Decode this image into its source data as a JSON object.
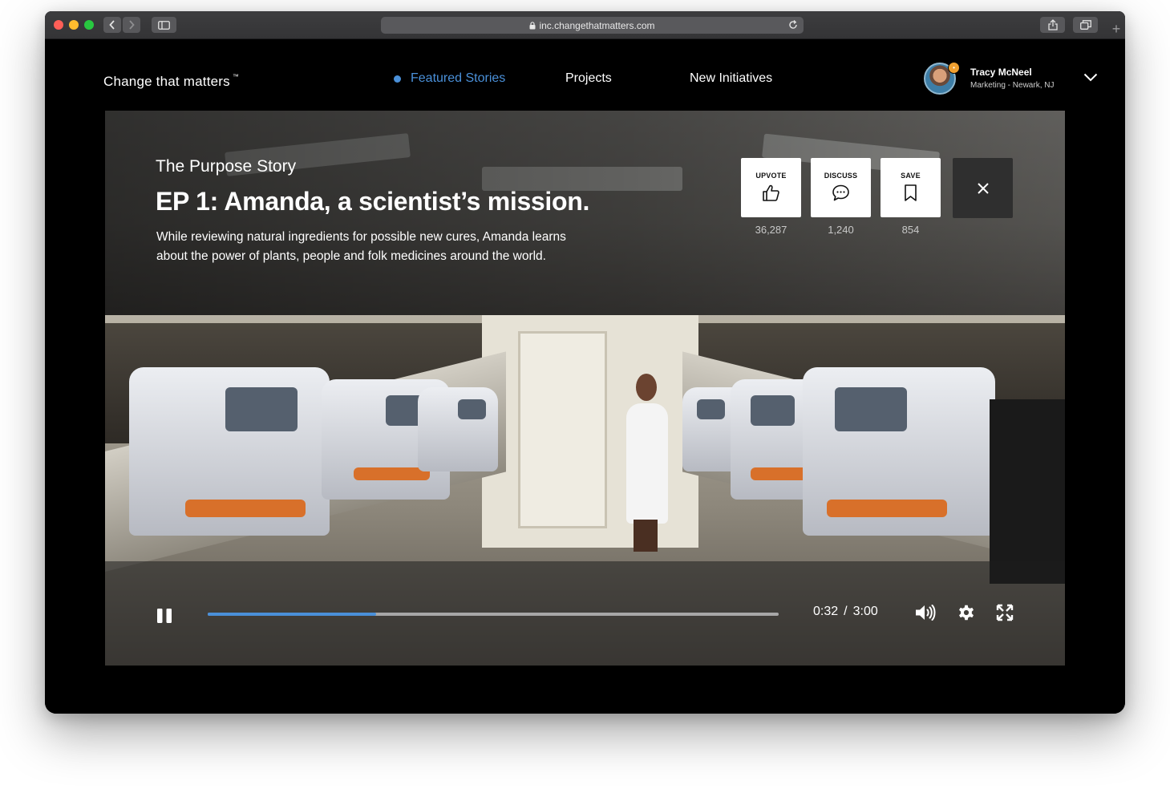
{
  "browser": {
    "url": "inc.changethatmatters.com"
  },
  "site": {
    "brand": "Change that matters",
    "brand_mark": "™",
    "nav": [
      {
        "label": "Featured Stories",
        "active": true
      },
      {
        "label": "Projects",
        "active": false
      },
      {
        "label": "New Initiatives",
        "active": false
      }
    ],
    "user": {
      "name": "Tracy McNeel",
      "subtitle": "Marketing - Newark, NJ"
    },
    "accent_color": "#4a90d9"
  },
  "story": {
    "series": "The Purpose Story",
    "title": "EP 1: Amanda, a scientist’s mission.",
    "description": "While reviewing natural ingredients for possible new cures, Amanda learns about the power of plants, people and folk medicines around the world.",
    "actions": [
      {
        "label": "UPVOTE",
        "count": "36,287",
        "icon": "thumbs-up-icon"
      },
      {
        "label": "DISCUSS",
        "count": "1,240",
        "icon": "speech-bubble-icon"
      },
      {
        "label": "SAVE",
        "count": "854",
        "icon": "bookmark-icon"
      }
    ]
  },
  "player": {
    "current_time": "0:32",
    "separator": "/",
    "duration": "3:00",
    "progress_fraction": 0.295
  }
}
